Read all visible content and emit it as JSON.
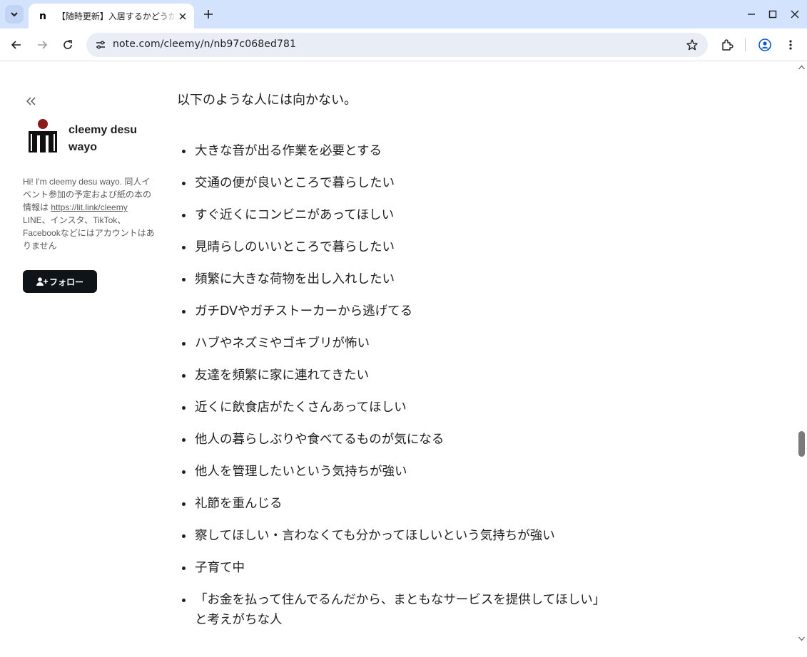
{
  "browser": {
    "tab_favicon": "n",
    "tab_title": "【随時更新】入居するかどうか",
    "url": "note.com/cleemy/n/nb97c068ed781",
    "icons": [
      "tab-search-icon",
      "close-icon",
      "plus-icon",
      "minimize-icon",
      "maximize-icon",
      "window-close-icon",
      "back-icon",
      "forward-icon",
      "reload-icon",
      "site-info-icon",
      "star-icon",
      "extensions-icon",
      "profile-icon",
      "menu-icon"
    ]
  },
  "sidebar": {
    "author_name": "cleemy desu wayo",
    "bio_text_1": "Hi! I'm cleemy desu wayo. 同人イベント参加の予定および紙の本の情報は ",
    "bio_link": "https://lit.link/cleemy",
    "bio_text_2": " LINE、インスタ、TikTok、Facebookなどにはアカウントはありません",
    "follow_label": "フォロー",
    "accent_color": "#0f1419",
    "avatar_color": "#8b1a1a"
  },
  "article": {
    "lead": "以下のような人には向かない。",
    "items": [
      "大きな音が出る作業を必要とする",
      "交通の便が良いところで暮らしたい",
      "すぐ近くにコンビニがあってほしい",
      "見晴らしのいいところで暮らしたい",
      "頻繁に大きな荷物を出し入れしたい",
      "ガチDVやガチストーカーから逃げてる",
      "ハブやネズミやゴキブリが怖い",
      "友達を頻繁に家に連れてきたい",
      "近くに飲食店がたくさんあってほしい",
      "他人の暮らしぶりや食べてるものが気になる",
      "他人を管理したいという気持ちが強い",
      "礼節を重んじる",
      "察してほしい・言わなくても分かってほしいという気持ちが強い",
      "子育て中"
    ],
    "last_item_line1": "「お金を払って住んでるんだから、まともなサービスを提供してほしい」",
    "last_item_line2": "と考えがちな人"
  }
}
